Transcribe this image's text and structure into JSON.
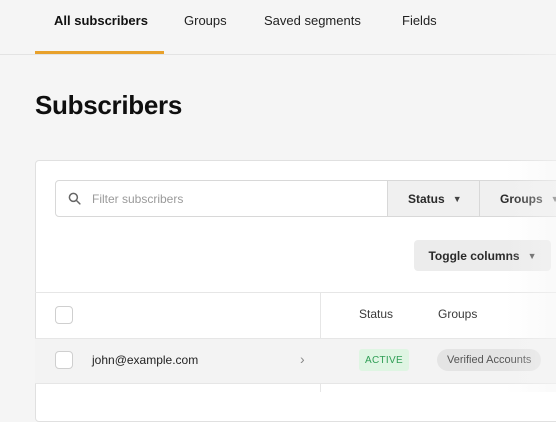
{
  "nav": {
    "tabs": [
      {
        "label": "All subscribers",
        "active": true
      },
      {
        "label": "Groups"
      },
      {
        "label": "Saved segments"
      },
      {
        "label": "Fields"
      }
    ],
    "accent_color": "#e8a12b"
  },
  "page": {
    "title": "Subscribers"
  },
  "toolbar": {
    "search_placeholder": "Filter subscribers",
    "status_label": "Status",
    "groups_label": "Groups",
    "toggle_columns_label": "Toggle columns"
  },
  "table": {
    "columns": [
      "Status",
      "Groups"
    ],
    "rows": [
      {
        "email": "john@example.com",
        "status": "ACTIVE",
        "group": "Verified Accounts"
      }
    ]
  }
}
